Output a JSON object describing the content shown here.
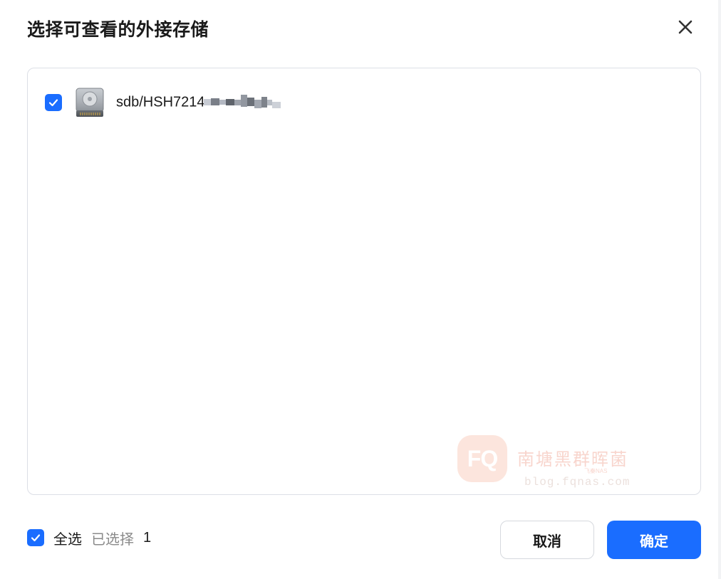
{
  "dialog": {
    "title": "选择可查看的外接存储",
    "close_icon": "close-icon"
  },
  "storage_list": {
    "items": [
      {
        "name": "sdb/HSH7214",
        "checked": true,
        "icon": "hard-disk-icon"
      }
    ]
  },
  "watermark": {
    "logo_text": "FQ",
    "name": "南塘黑群晖菌",
    "tag": "飞秦NAS",
    "url": "blog.fqnas.com"
  },
  "footer": {
    "select_all_label": "全选",
    "select_all_checked": true,
    "selected_label": "已选择",
    "selected_count": "1",
    "cancel_label": "取消",
    "confirm_label": "确定"
  },
  "colors": {
    "accent": "#1a6dff",
    "border": "#dcdfe6",
    "muted_text": "#8a8a8a"
  }
}
